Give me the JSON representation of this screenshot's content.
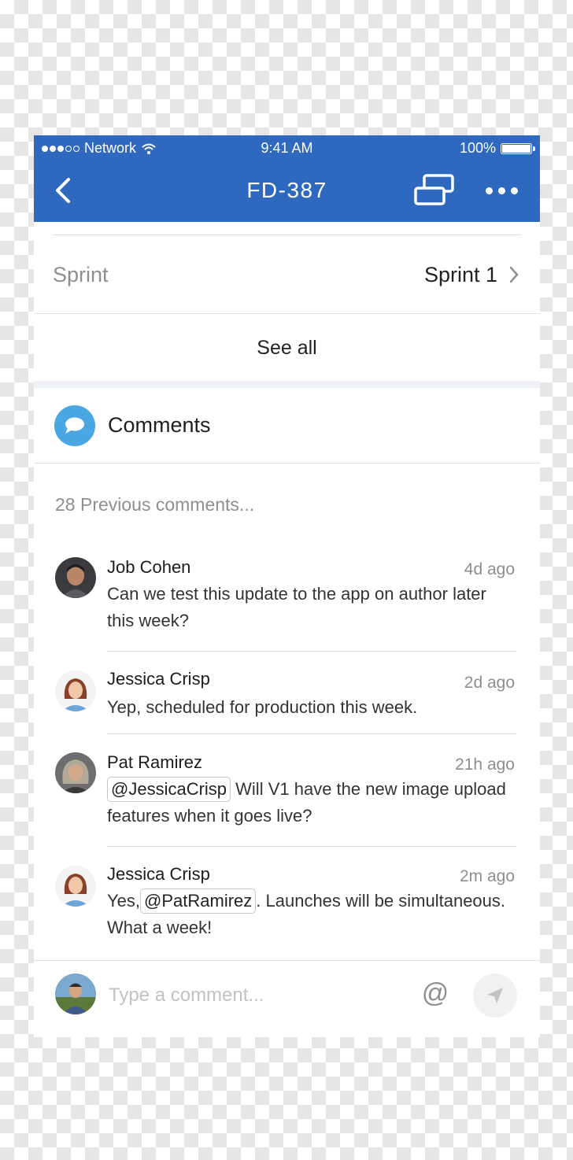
{
  "status_bar": {
    "carrier": "Network",
    "time": "9:41 AM",
    "battery": "100%"
  },
  "nav": {
    "title": "FD-387"
  },
  "sprint": {
    "label": "Sprint",
    "value": "Sprint 1"
  },
  "see_all": "See all",
  "comments": {
    "title": "Comments",
    "previous": "28 Previous comments...",
    "items": [
      {
        "author": "Job Cohen",
        "time": "4d ago",
        "text": "Can we test this update to the app on author later this week?"
      },
      {
        "author": "Jessica Crisp",
        "time": "2d ago",
        "text": "Yep, scheduled for production this week."
      },
      {
        "author": "Pat Ramirez",
        "time": "21h ago",
        "mention": "@JessicaCrisp",
        "text": "Will V1 have the new image upload features when it goes live?"
      },
      {
        "author": "Jessica Crisp",
        "time": "2m ago",
        "prefix": "Yes,",
        "mention": "@PatRamirez",
        "text": ". Launches will be simultaneous. What a week!"
      }
    ]
  },
  "composer": {
    "placeholder": "Type a comment...",
    "at_symbol": "@"
  },
  "colors": {
    "nav_bar": "#2f69bf",
    "comments_icon": "#4aa7e3"
  },
  "icons": [
    "back-chevron-icon",
    "screens-icon",
    "more-icon",
    "chevron-right-icon",
    "comment-bubble-icon",
    "at-icon",
    "send-icon"
  ]
}
